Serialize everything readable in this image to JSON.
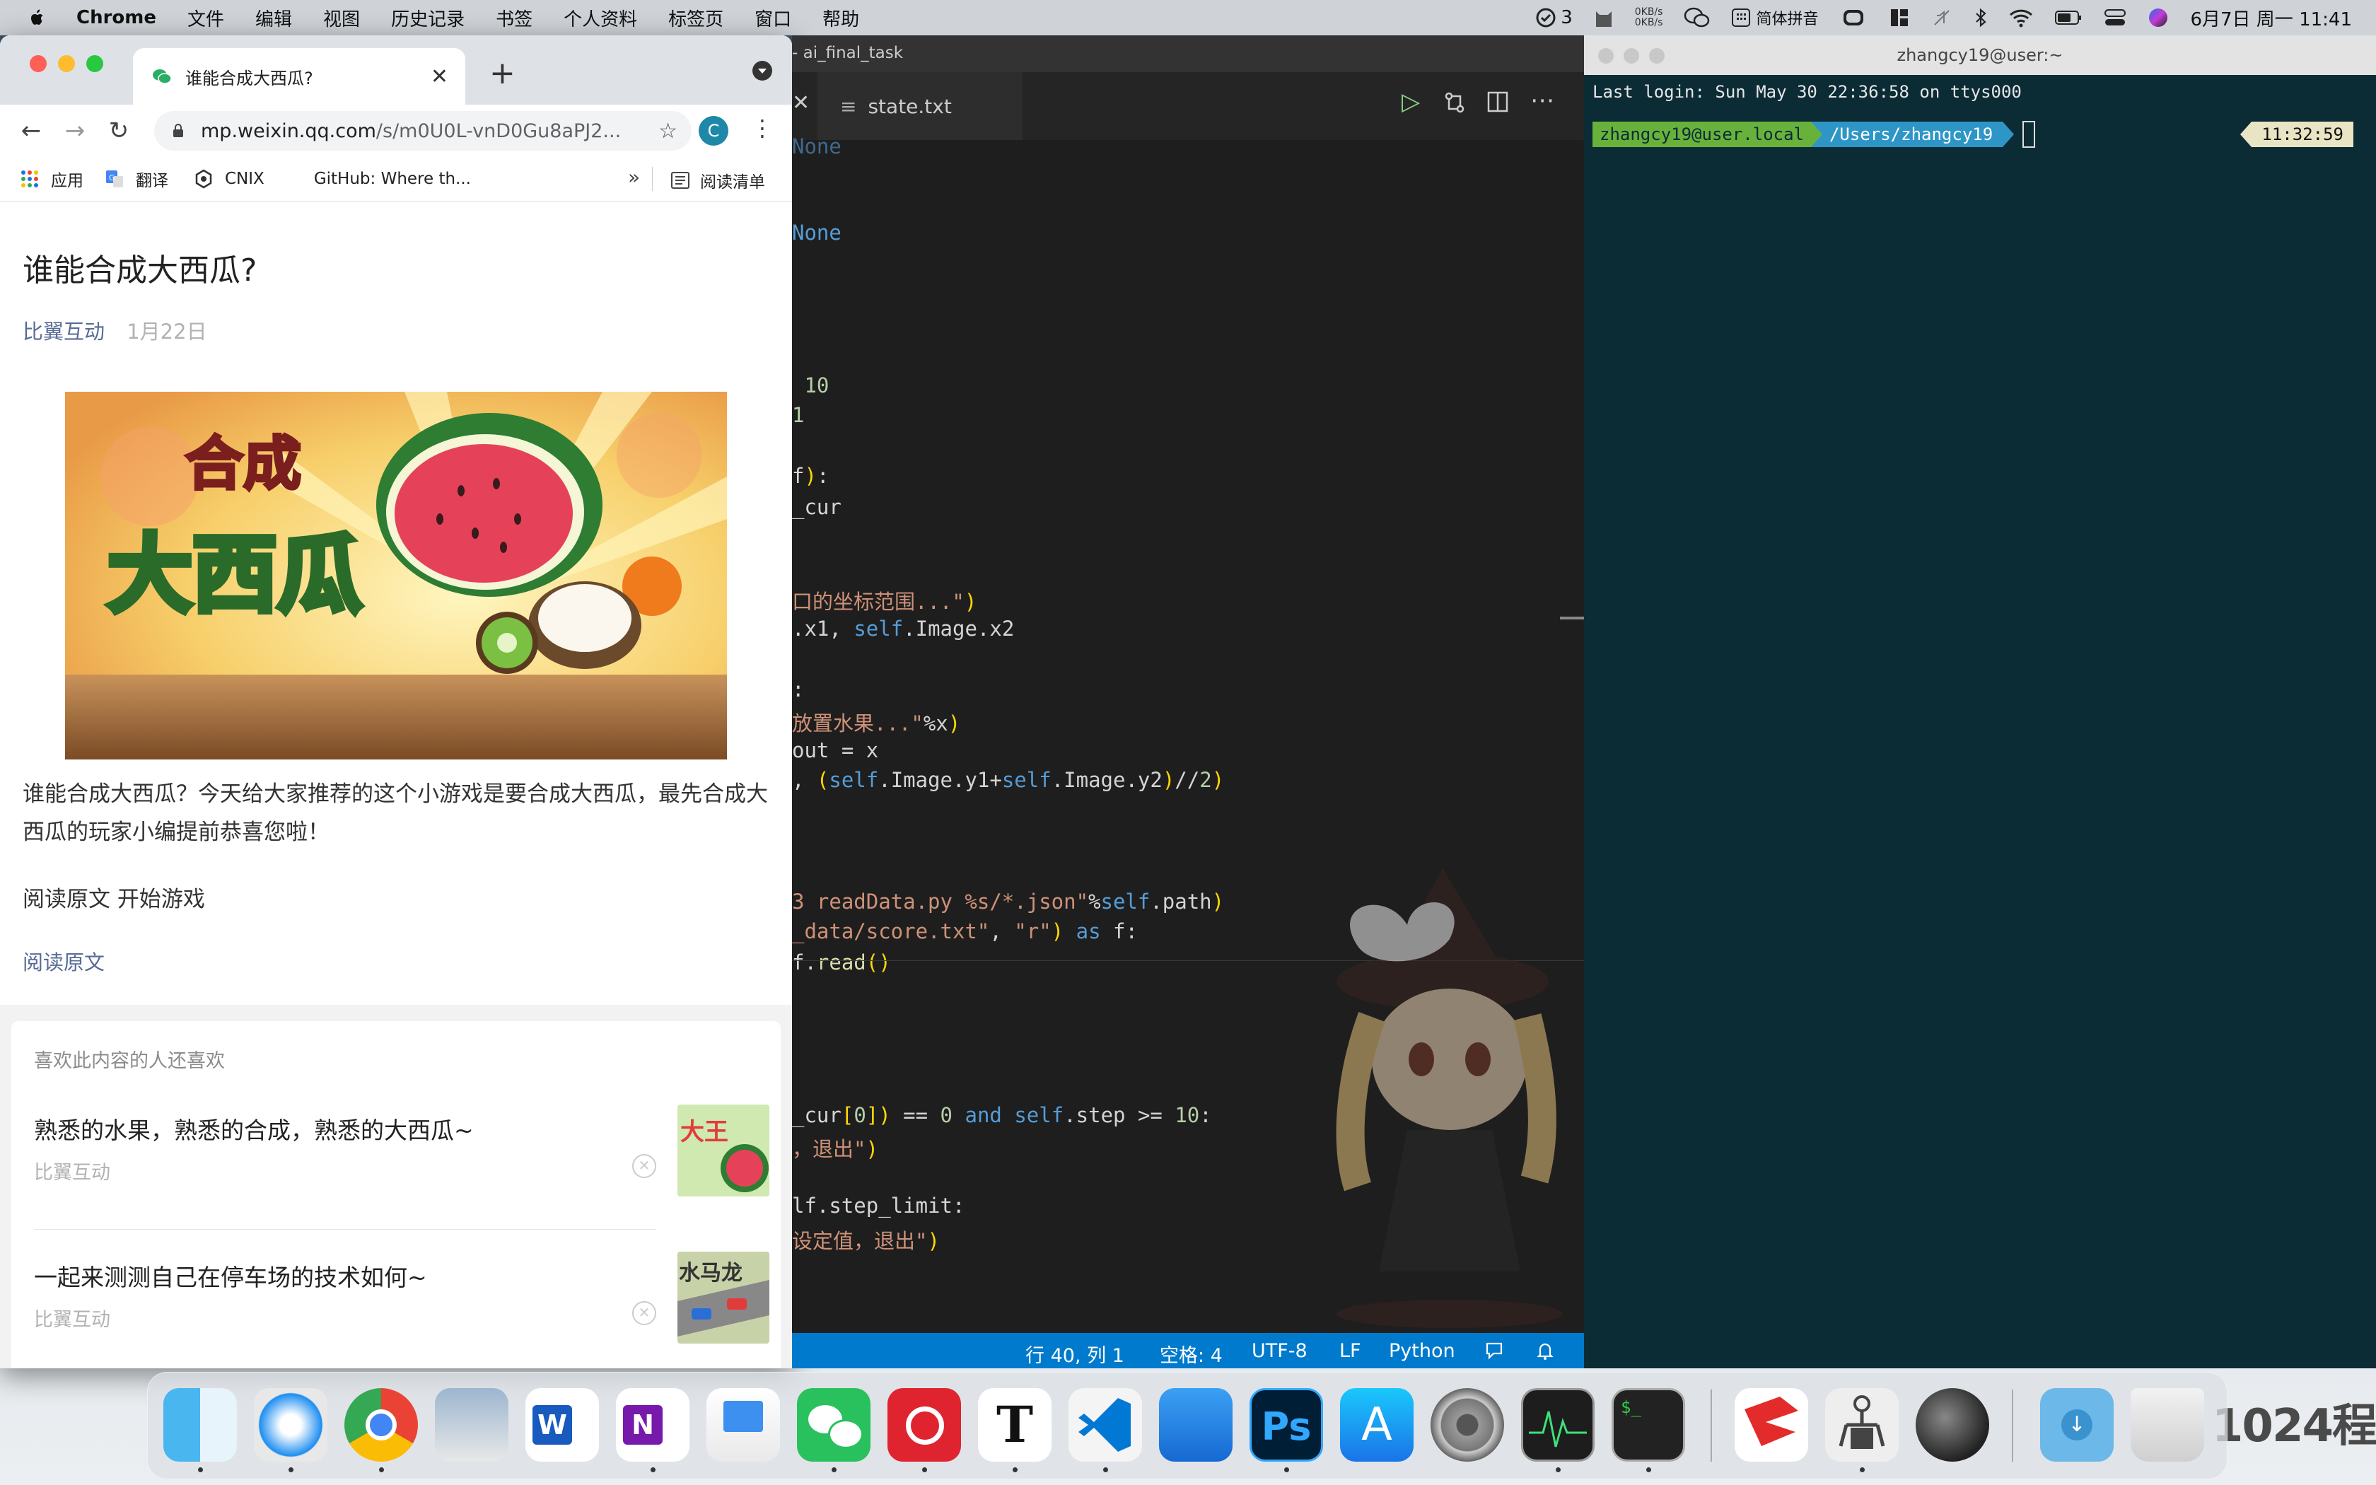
{
  "menubar": {
    "app": "Chrome",
    "items": [
      "文件",
      "编辑",
      "视图",
      "历史记录",
      "书签",
      "个人资料",
      "标签页",
      "窗口",
      "帮助"
    ],
    "status_count": "3",
    "net_up": "0KB/s",
    "net_down": "0KB/s",
    "input_method": "简体拼音",
    "clock": "6月7日 周一 11:41"
  },
  "chrome": {
    "tab_title": "谁能合成大西瓜?",
    "url_host": "mp.weixin.qq.com",
    "url_path": "/s/m0U0L-vnD0Gu8aPJ2...",
    "profile_initial": "C",
    "bookmarks": [
      "应用",
      "翻译",
      "CNIX",
      "GitHub: Where th..."
    ],
    "bookmark_more": "»",
    "reading_list": "阅读清单"
  },
  "article": {
    "title": "谁能合成大西瓜?",
    "author": "比翼互动",
    "date": "1月22日",
    "cover_text_1": "合成",
    "cover_text_2": "大西瓜",
    "body": "谁能合成大西瓜？今天给大家推荐的这个小游戏是要合成大西瓜，最先合成大西瓜的玩家小编提前恭喜您啦！",
    "cta": "阅读原文 开始游戏",
    "read_original": "阅读原文",
    "rec_heading": "喜欢此内容的人还喜欢",
    "rec_items": [
      {
        "title": "熟悉的水果，熟悉的合成，熟悉的大西瓜~",
        "source": "比翼互动",
        "thumb_text": "大王"
      },
      {
        "title": "一起来测测自己在停车场的技术如何~",
        "source": "比翼互动",
        "thumb_text": "水马龙"
      }
    ]
  },
  "vscode": {
    "title": "- ai_final_task",
    "tab": "state.txt",
    "status": {
      "position": "行 40, 列 1",
      "spaces": "空格: 4",
      "encoding": "UTF-8",
      "eol": "LF",
      "language": "Python"
    }
  },
  "terminal": {
    "title": "zhangcy19@user:~",
    "last_login": "Last login: Sun May 30 22:36:58 on ttys000",
    "prompt_user": "zhangcy19@user.local",
    "prompt_dir": "/Users/zhangcy19",
    "prompt_time": "11:32:59"
  },
  "wallpaper_mark": "1024程",
  "dock": {
    "apps": [
      "finder-icon",
      "safari-icon",
      "chrome-icon",
      "preview-icon",
      "word-icon",
      "onenote-icon",
      "keynote-icon",
      "wechat-icon",
      "netease-music-icon",
      "typora-icon",
      "vscode-icon",
      "xcode-icon",
      "photoshop-icon",
      "app-store-icon",
      "system-preferences-icon",
      "activity-monitor-icon",
      "terminal-icon",
      "wps-icon",
      "claw-app-icon",
      "dark-sphere-icon",
      "downloads-folder-icon",
      "trash-icon"
    ]
  }
}
